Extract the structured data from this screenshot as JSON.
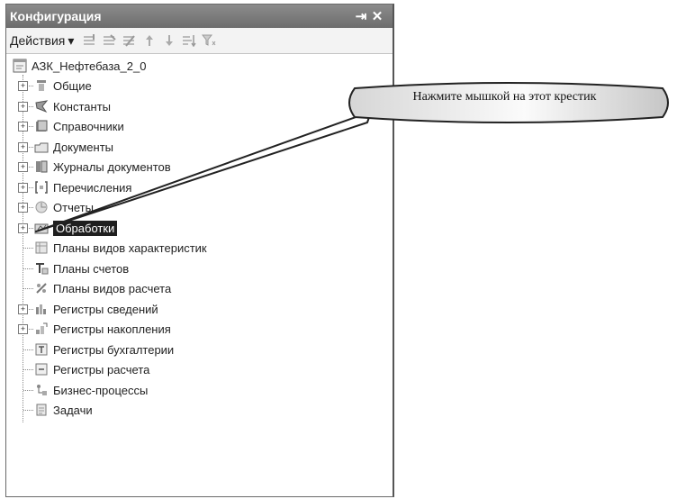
{
  "panel": {
    "title": "Конфигурация",
    "pin_glyph": "⇥",
    "close_glyph": "✕",
    "toolbar": {
      "actions_label": "Действия",
      "actions_arrow": "▾",
      "tools": [
        "add-icon",
        "copy-icon",
        "edit-icon",
        "move-up-icon",
        "move-down-icon",
        "sort-icon",
        "filter-icon"
      ]
    }
  },
  "tree": {
    "root": "АЗК_Нефтебаза_2_0",
    "items": [
      {
        "label": "Общие",
        "icon": "common-icon",
        "expand": true
      },
      {
        "label": "Константы",
        "icon": "constants-icon",
        "expand": true
      },
      {
        "label": "Справочники",
        "icon": "catalogs-icon",
        "expand": true
      },
      {
        "label": "Документы",
        "icon": "documents-icon",
        "expand": true
      },
      {
        "label": "Журналы документов",
        "icon": "journals-icon",
        "expand": true
      },
      {
        "label": "Перечисления",
        "icon": "enums-icon",
        "expand": true
      },
      {
        "label": "Отчеты",
        "icon": "reports-icon",
        "expand": true
      },
      {
        "label": "Обработки",
        "icon": "processing-icon",
        "expand": true,
        "selected": true
      },
      {
        "label": "Планы видов характеристик",
        "icon": "characteristic-plans-icon",
        "expand": false
      },
      {
        "label": "Планы счетов",
        "icon": "chart-of-accounts-icon",
        "expand": false
      },
      {
        "label": "Планы видов расчета",
        "icon": "calculation-plans-icon",
        "expand": false
      },
      {
        "label": "Регистры сведений",
        "icon": "info-registers-icon",
        "expand": true
      },
      {
        "label": "Регистры накопления",
        "icon": "accumulation-registers-icon",
        "expand": true
      },
      {
        "label": "Регистры бухгалтерии",
        "icon": "accounting-registers-icon",
        "expand": false
      },
      {
        "label": "Регистры расчета",
        "icon": "calculation-registers-icon",
        "expand": false
      },
      {
        "label": "Бизнес-процессы",
        "icon": "business-processes-icon",
        "expand": false
      },
      {
        "label": "Задачи",
        "icon": "tasks-icon",
        "expand": false
      }
    ]
  },
  "callout": {
    "text": "Нажмите мышкой на этот крестик"
  }
}
